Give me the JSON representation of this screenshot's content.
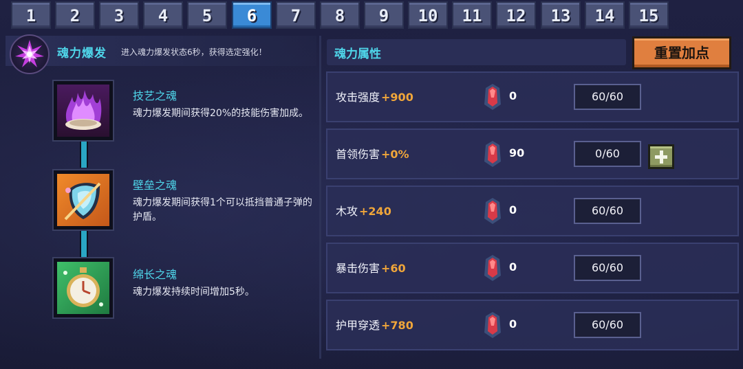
{
  "tabs": [
    "1",
    "2",
    "3",
    "4",
    "5",
    "6",
    "7",
    "8",
    "9",
    "10",
    "11",
    "12",
    "13",
    "14",
    "15"
  ],
  "active_tab": "6",
  "burst": {
    "title": "魂力爆发",
    "description": "进入魂力爆发状态6秒，获得选定强化！"
  },
  "skills": [
    {
      "name": "技艺之魂",
      "description": "魂力爆发期间获得20%的技能伤害加成。",
      "icon": "purple-flame-icon"
    },
    {
      "name": "壁垒之魂",
      "description": "魂力爆发期间获得1个可以抵挡普通子弹的护盾。",
      "icon": "shield-icon"
    },
    {
      "name": "绵长之魂",
      "description": "魂力爆发持续时间增加5秒。",
      "icon": "stopwatch-icon"
    }
  ],
  "attributes_title": "魂力属性",
  "reset_label": "重置加点",
  "attributes": [
    {
      "name": "攻击强度",
      "bonus": "+900",
      "gems": "0",
      "level": "60/60",
      "can_add": false
    },
    {
      "name": "首领伤害",
      "bonus": "+0%",
      "gems": "90",
      "level": "0/60",
      "can_add": true
    },
    {
      "name": "木攻",
      "bonus": "+240",
      "gems": "0",
      "level": "60/60",
      "can_add": false
    },
    {
      "name": "暴击伤害",
      "bonus": "+60",
      "gems": "0",
      "level": "60/60",
      "can_add": false
    },
    {
      "name": "护甲穿透",
      "bonus": "+780",
      "gems": "0",
      "level": "60/60",
      "can_add": false
    }
  ],
  "colors": {
    "accent_cyan": "#4fd6ea",
    "bonus_orange": "#f0a63a",
    "active_tab": "#3a8ad6",
    "reset_button": "#e07f3f"
  }
}
